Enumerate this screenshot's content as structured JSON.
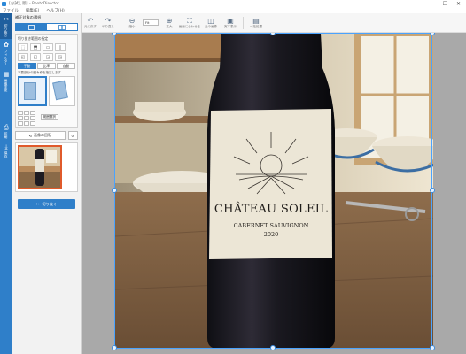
{
  "window": {
    "title": "[お試し版] - PhotoDirector",
    "controls": [
      "—",
      "☐",
      "✕"
    ]
  },
  "menu": [
    "ファイル",
    "編集(E)",
    "ヘルプ(H)"
  ],
  "toolbar": {
    "items": [
      {
        "icon": "undo-icon",
        "glyph": "↶",
        "label": "元に戻す"
      },
      {
        "icon": "redo-icon",
        "glyph": "↷",
        "label": "やり直し"
      },
      {
        "icon": "zoom-out-icon",
        "glyph": "⊖",
        "label": "縮小"
      },
      {
        "icon": "zoom-in-icon",
        "glyph": "⊕",
        "label": "拡大"
      },
      {
        "icon": "fit-icon",
        "glyph": "⛶",
        "label": "画面に合わせる"
      },
      {
        "icon": "compare-icon",
        "glyph": "◫",
        "label": "元の画像"
      },
      {
        "icon": "original-size-icon",
        "glyph": "▣",
        "label": "実寸表示"
      },
      {
        "icon": "batch-icon",
        "glyph": "▤",
        "label": "一括処理"
      }
    ],
    "zoom_value": "Fit"
  },
  "rail": [
    {
      "icon": "scissors-icon",
      "glyph": "✂",
      "label": "切り抜き",
      "active": true
    },
    {
      "icon": "filter-icon",
      "glyph": "✿",
      "label": "フィルター",
      "active": false
    },
    {
      "icon": "adjust-icon",
      "glyph": "▦",
      "label": "画像変更",
      "active": false
    },
    {
      "icon": "print-icon",
      "glyph": "⎙",
      "label": "印刷",
      "active": false
    },
    {
      "icon": "save-icon",
      "glyph": "⤓",
      "label": "保存",
      "active": false
    }
  ],
  "panel": {
    "header": "補正対象の選択",
    "section_title": "切り抜き範囲の指定",
    "ratio_tabs": [
      "手動",
      "比率",
      "自動"
    ],
    "hint": "不要部分の囲み枠を指定します",
    "range_select": "範囲選択",
    "rotate_button": "画像の回転",
    "crop_button": "切り抜く"
  },
  "colors": {
    "accent": "#2f7fc9",
    "canvas_bg": "#a9a9a9",
    "selection": "#e05a2b"
  },
  "photo": {
    "label_line1": "CHÂTEAU SOLEIL",
    "label_line2": "CABERNET SAUVIGNON",
    "label_line3": "2020"
  }
}
